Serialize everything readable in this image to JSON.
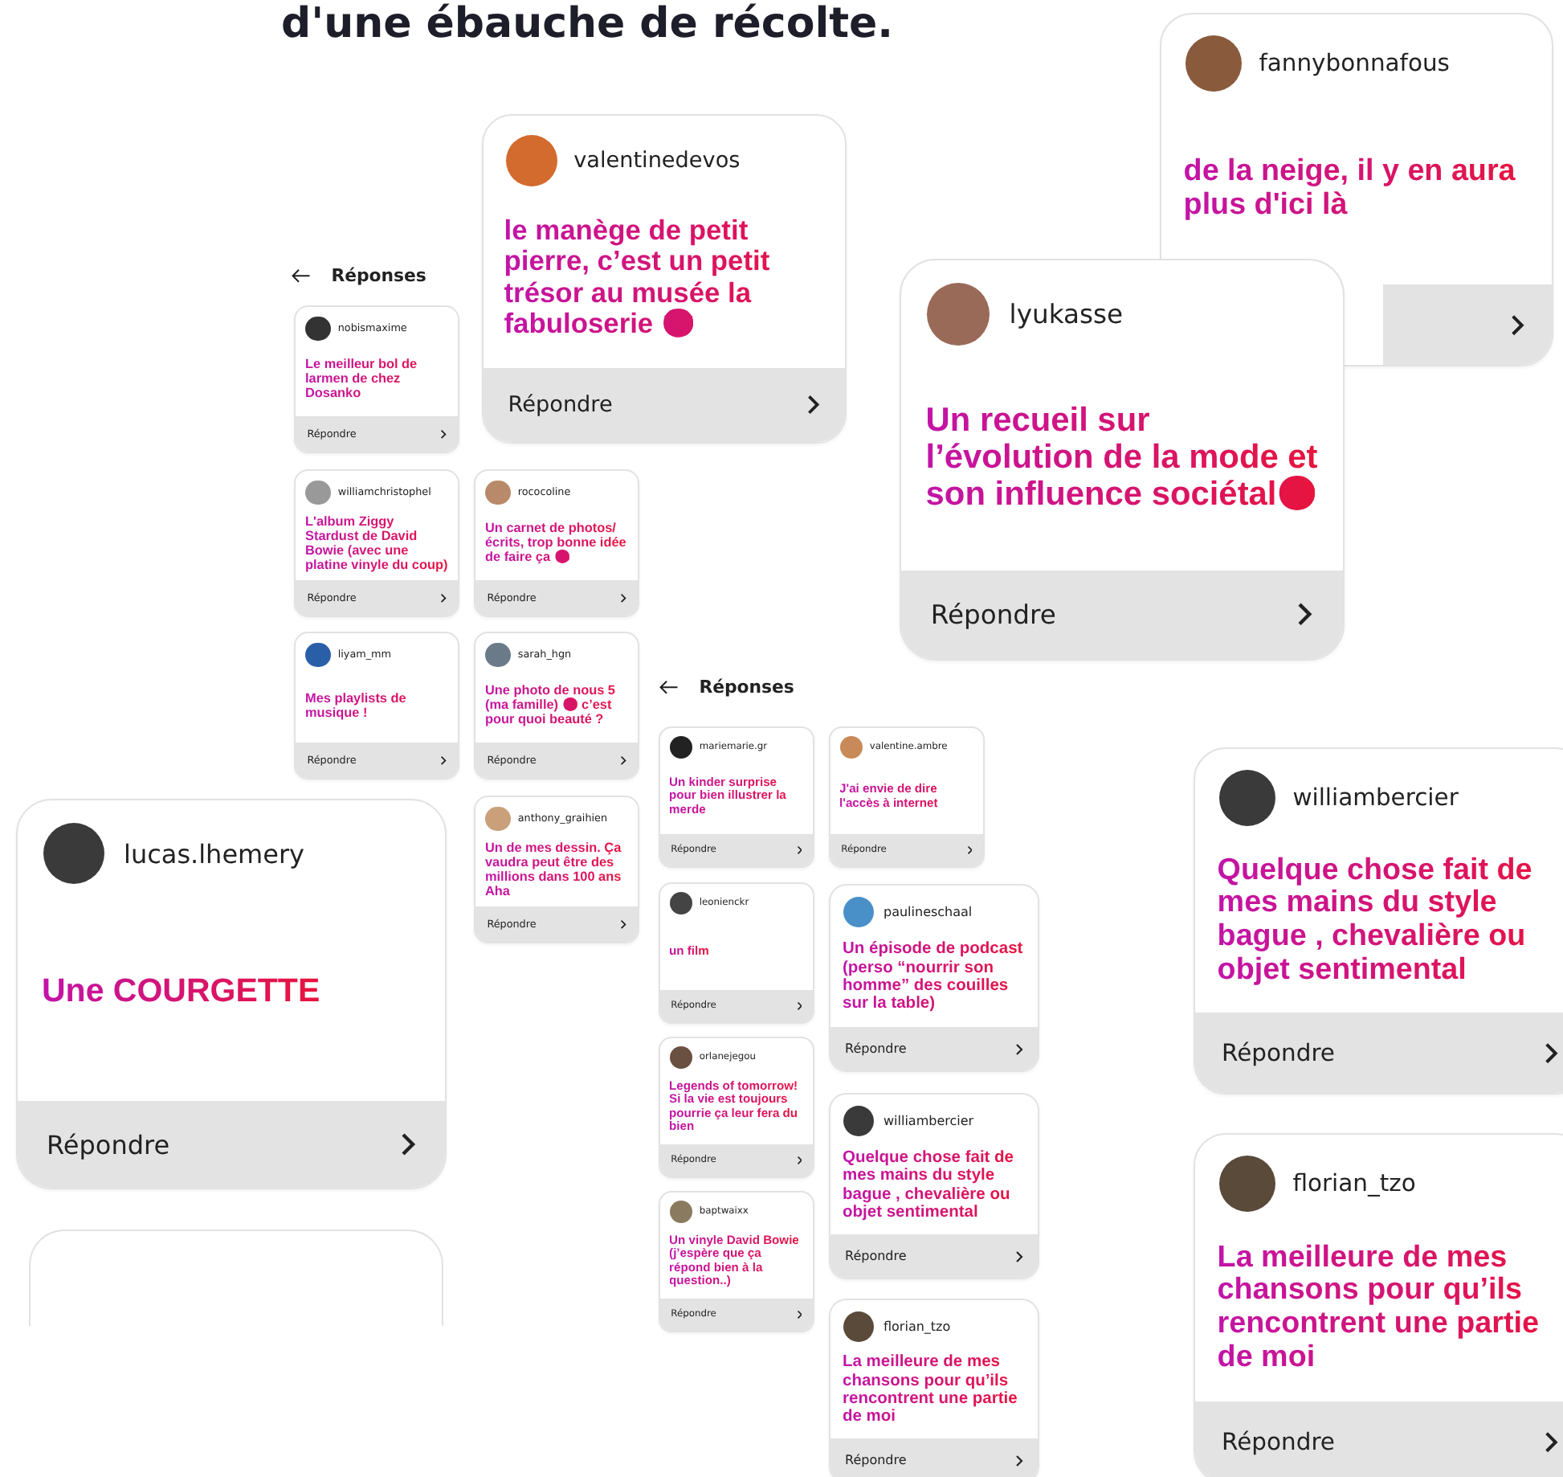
{
  "heading": "d'une ébauche de récolte.",
  "headers": [
    {
      "title": "Réponses"
    },
    {
      "title": "Réponses"
    }
  ],
  "cards": [
    {
      "username": "fannybonnafous",
      "message": "de la neige, il y en aura plus d'ici là"
    },
    {
      "username": "valentinedevos",
      "message": "le manège de petit pierre, c’est un petit trésor au musée la fabuloserie 🤩",
      "reply": "Répondre"
    },
    {
      "username": "nobismaxime",
      "message": "Le meilleur bol de larmen de chez Dosanko",
      "reply": "Répondre"
    },
    {
      "username": "williamchristophel",
      "message": "L'album Ziggy Stardust de David Bowie (avec une platine vinyle du coup)",
      "reply": "Répondre"
    },
    {
      "username": "rococoline",
      "message": "Un carnet de photos/ écrits, trop bonne idée de faire ça 😘",
      "reply": "Répondre"
    },
    {
      "username": "liyam_mm",
      "message": "Mes playlists de musique !",
      "reply": "Répondre"
    },
    {
      "username": "sarah_hgn",
      "message": "Une photo de nous 5 (ma famille) 🙂 c’est pour quoi beauté ?",
      "reply": "Répondre"
    },
    {
      "username": "anthony_graihien",
      "message": "Un de mes dessin. Ça vaudra peut être des millions dans 100 ans Aha",
      "reply": "Répondre"
    },
    {
      "username": "lyukasse",
      "message": "Un recueil sur l’évolution de la mode et son influence sociétal😄",
      "reply": "Répondre"
    },
    {
      "username": "lucas.lhemery",
      "message": "Une COURGETTE",
      "reply": "Répondre"
    },
    {
      "username": "mariemarie.gr",
      "message": "Un kinder surprise pour bien illustrer la merde",
      "reply": "Répondre"
    },
    {
      "username": "valentine.ambre",
      "message": "J'ai envie de dire l'accès à internet",
      "reply": "Répondre"
    },
    {
      "username": "leonienckr",
      "message": "un film",
      "reply": "Répondre"
    },
    {
      "username": "orlanejegou",
      "message": "Legends of tomorrow! Si la vie est toujours pourrie ça leur fera du bien",
      "reply": "Répondre"
    },
    {
      "username": "baptwaixx",
      "message": "Un vinyle David Bowie (j’espère que ça répond bien à la question..)",
      "reply": "Répondre"
    },
    {
      "username": "paulineschaal",
      "message": "Un épisode de podcast (perso “nourrir son homme” des couilles sur la table)",
      "reply": "Répondre"
    },
    {
      "username": "williambercier",
      "message": "Quelque chose fait de mes mains du style bague , chevalière ou objet sentimental",
      "reply": "Répondre"
    },
    {
      "username": "florian_tzo",
      "message": "La meilleure de mes chansons pour qu’ils rencontrent une partie de moi",
      "reply": "Répondre"
    },
    {
      "username": "williambercier",
      "message": "Quelque chose fait de mes mains du style bague , chevalière ou objet sentimental",
      "reply": "Répondre"
    },
    {
      "username": "florian_tzo",
      "message": "La meilleure de mes chansons pour qu’ils rencontrent une partie de moi",
      "reply": "Répondre"
    }
  ]
}
